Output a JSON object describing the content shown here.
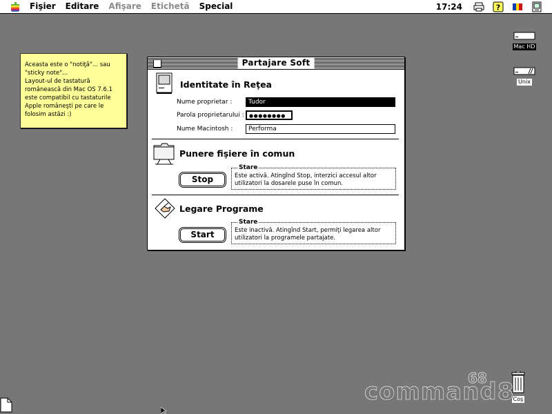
{
  "menubar": {
    "items": [
      {
        "label": "Fişier",
        "enabled": true
      },
      {
        "label": "Editare",
        "enabled": true
      },
      {
        "label": "Afişare",
        "enabled": false
      },
      {
        "label": "Etichetă",
        "enabled": false
      },
      {
        "label": "Special",
        "enabled": true
      }
    ],
    "clock": "17:24",
    "icons": [
      "apple-logo",
      "printer-icon",
      "help-icon",
      "keyboard-layout-flag-icon",
      "application-menu-icon"
    ]
  },
  "desktop": {
    "icons": [
      {
        "name": "hard-disk-icon",
        "label": "Mac HD",
        "selected": true
      },
      {
        "name": "volume-icon",
        "label": "Unix",
        "selected": false
      },
      {
        "name": "trash-icon",
        "label": "Coş",
        "selected": false
      }
    ],
    "watermark": "command8",
    "watermark_small": "68"
  },
  "sticky_note": {
    "text": "Aceasta este o \"notiţă\"... sau\n\"sticky note\"...\nLayout-ul de tastatură\nromânească din Mac OS 7.6.1\neste compatibil cu tastaturile\nApple româneşti pe care le\nfolosim astăzi :)"
  },
  "window": {
    "title": "Partajare Soft",
    "identity": {
      "heading": "Identitate în Reţea",
      "owner_label": "Nume proprietar :",
      "owner_value": "Tudor",
      "password_label": "Parola proprietarului :",
      "password_value": "●●●●●●●●",
      "machine_label": "Nume Macintosh :",
      "machine_value": "Performa"
    },
    "file_sharing": {
      "heading": "Punere fişiere în comun",
      "button": "Stop",
      "status_title": "Stare",
      "status_text": "Este activă. Atingînd Stop, interzici accesul altor utilizatori la dosarele puse în comun."
    },
    "program_linking": {
      "heading": "Legare Programe",
      "button": "Start",
      "status_title": "Stare",
      "status_text": "Este inactivă. Atingînd Start, permiţi legarea altor utilizatori la programele partajate."
    }
  },
  "colors": {
    "desktop": "#777777",
    "sticky": "#ffff9a"
  }
}
